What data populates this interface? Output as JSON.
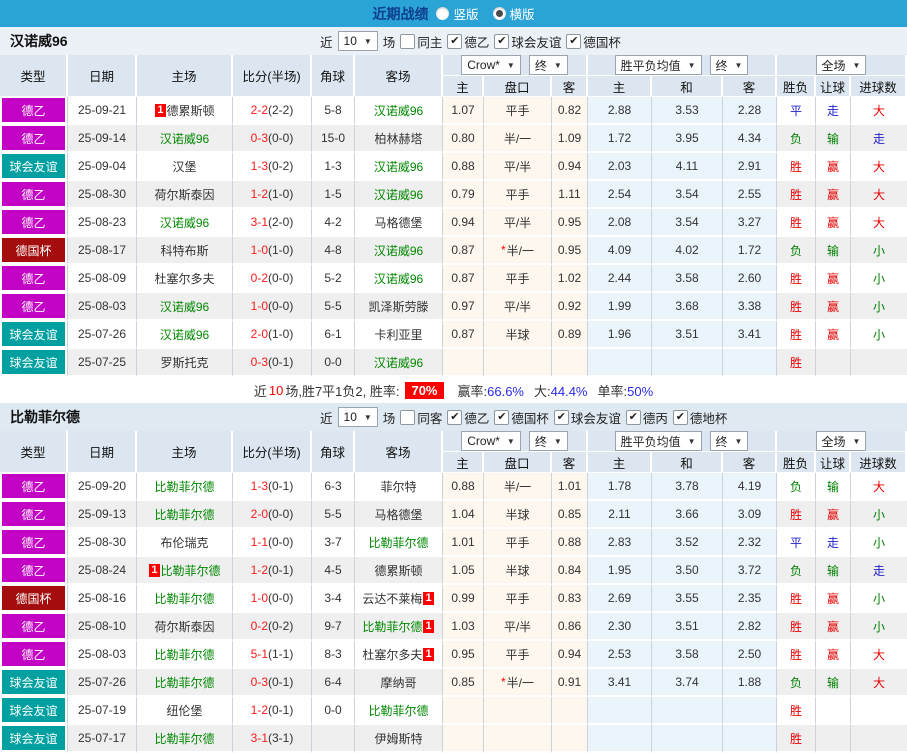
{
  "topbar": {
    "title": "近期战绩",
    "radios": [
      {
        "label": "竖版",
        "checked": false
      },
      {
        "label": "横版",
        "checked": true
      }
    ]
  },
  "colors": {
    "topbar": "#2aa3d6",
    "league2": "#c303c3",
    "friendly": "#00a0a0",
    "cup": "#a40d0d",
    "team_highlight": "#008800",
    "win": "#e60000",
    "draw": "#2121cc",
    "lose": "#008000",
    "odds_bg": "#fdf7ee",
    "mean_bg": "#e9f4fb"
  },
  "table_header": {
    "left_cols": [
      "类型",
      "日期",
      "主场",
      "比分(半场)",
      "角球",
      "客场"
    ],
    "groups": [
      {
        "selects": [
          "Crow*",
          "终"
        ]
      },
      {
        "selects": [
          "胜平负均值",
          "终"
        ]
      },
      {
        "selects": [
          "全场"
        ]
      }
    ],
    "sub_cols": [
      "主",
      "盘口",
      "客",
      "主",
      "和",
      "客",
      "胜负",
      "让球",
      "进球数"
    ]
  },
  "sections": [
    {
      "team": "汉诺威96",
      "filter": {
        "near": "近",
        "count": "10",
        "unit": "场",
        "uncheck_label": "同主",
        "leagues": [
          "德乙",
          "球会友谊",
          "德国杯"
        ]
      },
      "rows": [
        {
          "type": "德乙",
          "type_key": "l2",
          "date": "25-09-21",
          "home": {
            "name": "德累斯顿",
            "green": false,
            "badge": "L"
          },
          "score": "2-2",
          "half": "(2-2)",
          "corner": "5-8",
          "away": {
            "name": "汉诺威96",
            "green": true
          },
          "star": false,
          "odds": [
            "1.07",
            "平手",
            "0.82"
          ],
          "mean": [
            "2.88",
            "3.53",
            "2.28"
          ],
          "res": {
            "t": "平",
            "c": "b"
          },
          "let": {
            "t": "走",
            "c": "b"
          },
          "goal": {
            "t": "大",
            "c": "r"
          }
        },
        {
          "type": "德乙",
          "type_key": "l2",
          "date": "25-09-14",
          "home": {
            "name": "汉诺威96",
            "green": true
          },
          "score": "0-3",
          "half": "(0-0)",
          "corner": "15-0",
          "away": {
            "name": "柏林赫塔",
            "green": false
          },
          "star": false,
          "odds": [
            "0.80",
            "半/一",
            "1.09"
          ],
          "mean": [
            "1.72",
            "3.95",
            "4.34"
          ],
          "res": {
            "t": "负",
            "c": "g"
          },
          "let": {
            "t": "输",
            "c": "g"
          },
          "goal": {
            "t": "走",
            "c": "b"
          }
        },
        {
          "type": "球会友谊",
          "type_key": "fr",
          "date": "25-09-04",
          "home": {
            "name": "汉堡",
            "green": false
          },
          "score": "1-3",
          "half": "(0-2)",
          "corner": "1-3",
          "away": {
            "name": "汉诺威96",
            "green": true
          },
          "star": false,
          "odds": [
            "0.88",
            "平/半",
            "0.94"
          ],
          "mean": [
            "2.03",
            "4.11",
            "2.91"
          ],
          "res": {
            "t": "胜",
            "c": "r"
          },
          "let": {
            "t": "赢",
            "c": "r"
          },
          "goal": {
            "t": "大",
            "c": "r"
          }
        },
        {
          "type": "德乙",
          "type_key": "l2",
          "date": "25-08-30",
          "home": {
            "name": "荷尔斯泰因",
            "green": false
          },
          "score": "1-2",
          "half": "(1-0)",
          "corner": "1-5",
          "away": {
            "name": "汉诺威96",
            "green": true
          },
          "star": false,
          "odds": [
            "0.79",
            "平手",
            "1.11"
          ],
          "mean": [
            "2.54",
            "3.54",
            "2.55"
          ],
          "res": {
            "t": "胜",
            "c": "r"
          },
          "let": {
            "t": "赢",
            "c": "r"
          },
          "goal": {
            "t": "大",
            "c": "r"
          }
        },
        {
          "type": "德乙",
          "type_key": "l2",
          "date": "25-08-23",
          "home": {
            "name": "汉诺威96",
            "green": true
          },
          "score": "3-1",
          "half": "(2-0)",
          "corner": "4-2",
          "away": {
            "name": "马格德堡",
            "green": false
          },
          "star": false,
          "odds": [
            "0.94",
            "平/半",
            "0.95"
          ],
          "mean": [
            "2.08",
            "3.54",
            "3.27"
          ],
          "res": {
            "t": "胜",
            "c": "r"
          },
          "let": {
            "t": "赢",
            "c": "r"
          },
          "goal": {
            "t": "大",
            "c": "r"
          }
        },
        {
          "type": "德国杯",
          "type_key": "cup",
          "date": "25-08-17",
          "home": {
            "name": "科特布斯",
            "green": false
          },
          "score": "1-0",
          "half": "(1-0)",
          "corner": "4-8",
          "away": {
            "name": "汉诺威96",
            "green": true
          },
          "star": true,
          "odds": [
            "0.87",
            "半/一",
            "0.95"
          ],
          "mean": [
            "4.09",
            "4.02",
            "1.72"
          ],
          "res": {
            "t": "负",
            "c": "g"
          },
          "let": {
            "t": "输",
            "c": "g"
          },
          "goal": {
            "t": "小",
            "c": "g"
          }
        },
        {
          "type": "德乙",
          "type_key": "l2",
          "date": "25-08-09",
          "home": {
            "name": "杜塞尔多夫",
            "green": false
          },
          "score": "0-2",
          "half": "(0-0)",
          "corner": "5-2",
          "away": {
            "name": "汉诺威96",
            "green": true
          },
          "star": false,
          "odds": [
            "0.87",
            "平手",
            "1.02"
          ],
          "mean": [
            "2.44",
            "3.58",
            "2.60"
          ],
          "res": {
            "t": "胜",
            "c": "r"
          },
          "let": {
            "t": "赢",
            "c": "r"
          },
          "goal": {
            "t": "小",
            "c": "g"
          }
        },
        {
          "type": "德乙",
          "type_key": "l2",
          "date": "25-08-03",
          "home": {
            "name": "汉诺威96",
            "green": true
          },
          "score": "1-0",
          "half": "(0-0)",
          "corner": "5-5",
          "away": {
            "name": "凯泽斯劳滕",
            "green": false
          },
          "star": false,
          "odds": [
            "0.97",
            "平/半",
            "0.92"
          ],
          "mean": [
            "1.99",
            "3.68",
            "3.38"
          ],
          "res": {
            "t": "胜",
            "c": "r"
          },
          "let": {
            "t": "赢",
            "c": "r"
          },
          "goal": {
            "t": "小",
            "c": "g"
          }
        },
        {
          "type": "球会友谊",
          "type_key": "fr",
          "date": "25-07-26",
          "home": {
            "name": "汉诺威96",
            "green": true
          },
          "score": "2-0",
          "half": "(1-0)",
          "corner": "6-1",
          "away": {
            "name": "卡利亚里",
            "green": false
          },
          "star": false,
          "odds": [
            "0.87",
            "半球",
            "0.89"
          ],
          "mean": [
            "1.96",
            "3.51",
            "3.41"
          ],
          "res": {
            "t": "胜",
            "c": "r"
          },
          "let": {
            "t": "赢",
            "c": "r"
          },
          "goal": {
            "t": "小",
            "c": "g"
          }
        },
        {
          "type": "球会友谊",
          "type_key": "fr",
          "date": "25-07-25",
          "home": {
            "name": "罗斯托克",
            "green": false
          },
          "score": "0-3",
          "half": "(0-1)",
          "corner": "0-0",
          "away": {
            "name": "汉诺威96",
            "green": true
          },
          "star": false,
          "odds": [
            "",
            "",
            ""
          ],
          "mean": [
            "",
            "",
            ""
          ],
          "res": {
            "t": "胜",
            "c": "r"
          },
          "let": {
            "t": "",
            "c": "r"
          },
          "goal": {
            "t": "",
            "c": "r"
          }
        }
      ],
      "summary": {
        "pre": "近",
        "count": "10",
        "mid": "场,胜7平1负2, 胜率:",
        "rate": "70%",
        "stats": [
          {
            "label": "赢率:",
            "value": "66.6%"
          },
          {
            "label": "大:",
            "value": "44.4%"
          },
          {
            "label": "单率:",
            "value": "50%"
          }
        ]
      }
    },
    {
      "team": "比勒菲尔德",
      "filter": {
        "near": "近",
        "count": "10",
        "unit": "场",
        "uncheck_label": "同客",
        "leagues": [
          "德乙",
          "德国杯",
          "球会友谊",
          "德丙",
          "德地杯"
        ]
      },
      "rows": [
        {
          "type": "德乙",
          "type_key": "l2",
          "date": "25-09-20",
          "home": {
            "name": "比勒菲尔德",
            "green": true
          },
          "score": "1-3",
          "half": "(0-1)",
          "corner": "6-3",
          "away": {
            "name": "菲尔特",
            "green": false
          },
          "star": false,
          "odds": [
            "0.88",
            "半/一",
            "1.01"
          ],
          "mean": [
            "1.78",
            "3.78",
            "4.19"
          ],
          "res": {
            "t": "负",
            "c": "g"
          },
          "let": {
            "t": "输",
            "c": "g"
          },
          "goal": {
            "t": "大",
            "c": "r"
          }
        },
        {
          "type": "德乙",
          "type_key": "l2",
          "date": "25-09-13",
          "home": {
            "name": "比勒菲尔德",
            "green": true
          },
          "score": "2-0",
          "half": "(0-0)",
          "corner": "5-5",
          "away": {
            "name": "马格德堡",
            "green": false
          },
          "star": false,
          "odds": [
            "1.04",
            "半球",
            "0.85"
          ],
          "mean": [
            "2.11",
            "3.66",
            "3.09"
          ],
          "res": {
            "t": "胜",
            "c": "r"
          },
          "let": {
            "t": "赢",
            "c": "r"
          },
          "goal": {
            "t": "小",
            "c": "g"
          }
        },
        {
          "type": "德乙",
          "type_key": "l2",
          "date": "25-08-30",
          "home": {
            "name": "布伦瑞克",
            "green": false
          },
          "score": "1-1",
          "half": "(0-0)",
          "corner": "3-7",
          "away": {
            "name": "比勒菲尔德",
            "green": true
          },
          "star": false,
          "odds": [
            "1.01",
            "平手",
            "0.88"
          ],
          "mean": [
            "2.83",
            "3.52",
            "2.32"
          ],
          "res": {
            "t": "平",
            "c": "b"
          },
          "let": {
            "t": "走",
            "c": "b"
          },
          "goal": {
            "t": "小",
            "c": "g"
          }
        },
        {
          "type": "德乙",
          "type_key": "l2",
          "date": "25-08-24",
          "home": {
            "name": "比勒菲尔德",
            "green": true,
            "badge": "L"
          },
          "score": "1-2",
          "half": "(0-1)",
          "corner": "4-5",
          "away": {
            "name": "德累斯顿",
            "green": false
          },
          "star": false,
          "odds": [
            "1.05",
            "半球",
            "0.84"
          ],
          "mean": [
            "1.95",
            "3.50",
            "3.72"
          ],
          "res": {
            "t": "负",
            "c": "g"
          },
          "let": {
            "t": "输",
            "c": "g"
          },
          "goal": {
            "t": "走",
            "c": "b"
          }
        },
        {
          "type": "德国杯",
          "type_key": "cup",
          "date": "25-08-16",
          "home": {
            "name": "比勒菲尔德",
            "green": true
          },
          "score": "1-0",
          "half": "(0-0)",
          "corner": "3-4",
          "away": {
            "name": "云达不莱梅",
            "green": false,
            "badge": "R"
          },
          "star": false,
          "odds": [
            "0.99",
            "平手",
            "0.83"
          ],
          "mean": [
            "2.69",
            "3.55",
            "2.35"
          ],
          "res": {
            "t": "胜",
            "c": "r"
          },
          "let": {
            "t": "赢",
            "c": "r"
          },
          "goal": {
            "t": "小",
            "c": "g"
          }
        },
        {
          "type": "德乙",
          "type_key": "l2",
          "date": "25-08-10",
          "home": {
            "name": "荷尔斯泰因",
            "green": false
          },
          "score": "0-2",
          "half": "(0-2)",
          "corner": "9-7",
          "away": {
            "name": "比勒菲尔德",
            "green": true,
            "badge": "R"
          },
          "star": false,
          "odds": [
            "1.03",
            "平/半",
            "0.86"
          ],
          "mean": [
            "2.30",
            "3.51",
            "2.82"
          ],
          "res": {
            "t": "胜",
            "c": "r"
          },
          "let": {
            "t": "赢",
            "c": "r"
          },
          "goal": {
            "t": "小",
            "c": "g"
          }
        },
        {
          "type": "德乙",
          "type_key": "l2",
          "date": "25-08-03",
          "home": {
            "name": "比勒菲尔德",
            "green": true
          },
          "score": "5-1",
          "half": "(1-1)",
          "corner": "8-3",
          "away": {
            "name": "杜塞尔多夫",
            "green": false,
            "badge": "R"
          },
          "star": false,
          "odds": [
            "0.95",
            "平手",
            "0.94"
          ],
          "mean": [
            "2.53",
            "3.58",
            "2.50"
          ],
          "res": {
            "t": "胜",
            "c": "r"
          },
          "let": {
            "t": "赢",
            "c": "r"
          },
          "goal": {
            "t": "大",
            "c": "r"
          }
        },
        {
          "type": "球会友谊",
          "type_key": "fr",
          "date": "25-07-26",
          "home": {
            "name": "比勒菲尔德",
            "green": true
          },
          "score": "0-3",
          "half": "(0-1)",
          "corner": "6-4",
          "away": {
            "name": "摩纳哥",
            "green": false
          },
          "star": true,
          "odds": [
            "0.85",
            "半/一",
            "0.91"
          ],
          "mean": [
            "3.41",
            "3.74",
            "1.88"
          ],
          "res": {
            "t": "负",
            "c": "g"
          },
          "let": {
            "t": "输",
            "c": "g"
          },
          "goal": {
            "t": "大",
            "c": "r"
          }
        },
        {
          "type": "球会友谊",
          "type_key": "fr",
          "date": "25-07-19",
          "home": {
            "name": "纽伦堡",
            "green": false
          },
          "score": "1-2",
          "half": "(0-1)",
          "corner": "0-0",
          "away": {
            "name": "比勒菲尔德",
            "green": true
          },
          "star": false,
          "odds": [
            "",
            "",
            ""
          ],
          "mean": [
            "",
            "",
            ""
          ],
          "res": {
            "t": "胜",
            "c": "r"
          },
          "let": {
            "t": "",
            "c": "r"
          },
          "goal": {
            "t": "",
            "c": "r"
          }
        },
        {
          "type": "球会友谊",
          "type_key": "fr",
          "date": "25-07-17",
          "home": {
            "name": "比勒菲尔德",
            "green": true
          },
          "score": "3-1",
          "half": "(3-1)",
          "corner": "",
          "away": {
            "name": "伊姆斯特",
            "green": false
          },
          "star": false,
          "odds": [
            "",
            "",
            ""
          ],
          "mean": [
            "",
            "",
            ""
          ],
          "res": {
            "t": "胜",
            "c": "r"
          },
          "let": {
            "t": "",
            "c": "r"
          },
          "goal": {
            "t": "",
            "c": "r"
          }
        }
      ]
    }
  ]
}
